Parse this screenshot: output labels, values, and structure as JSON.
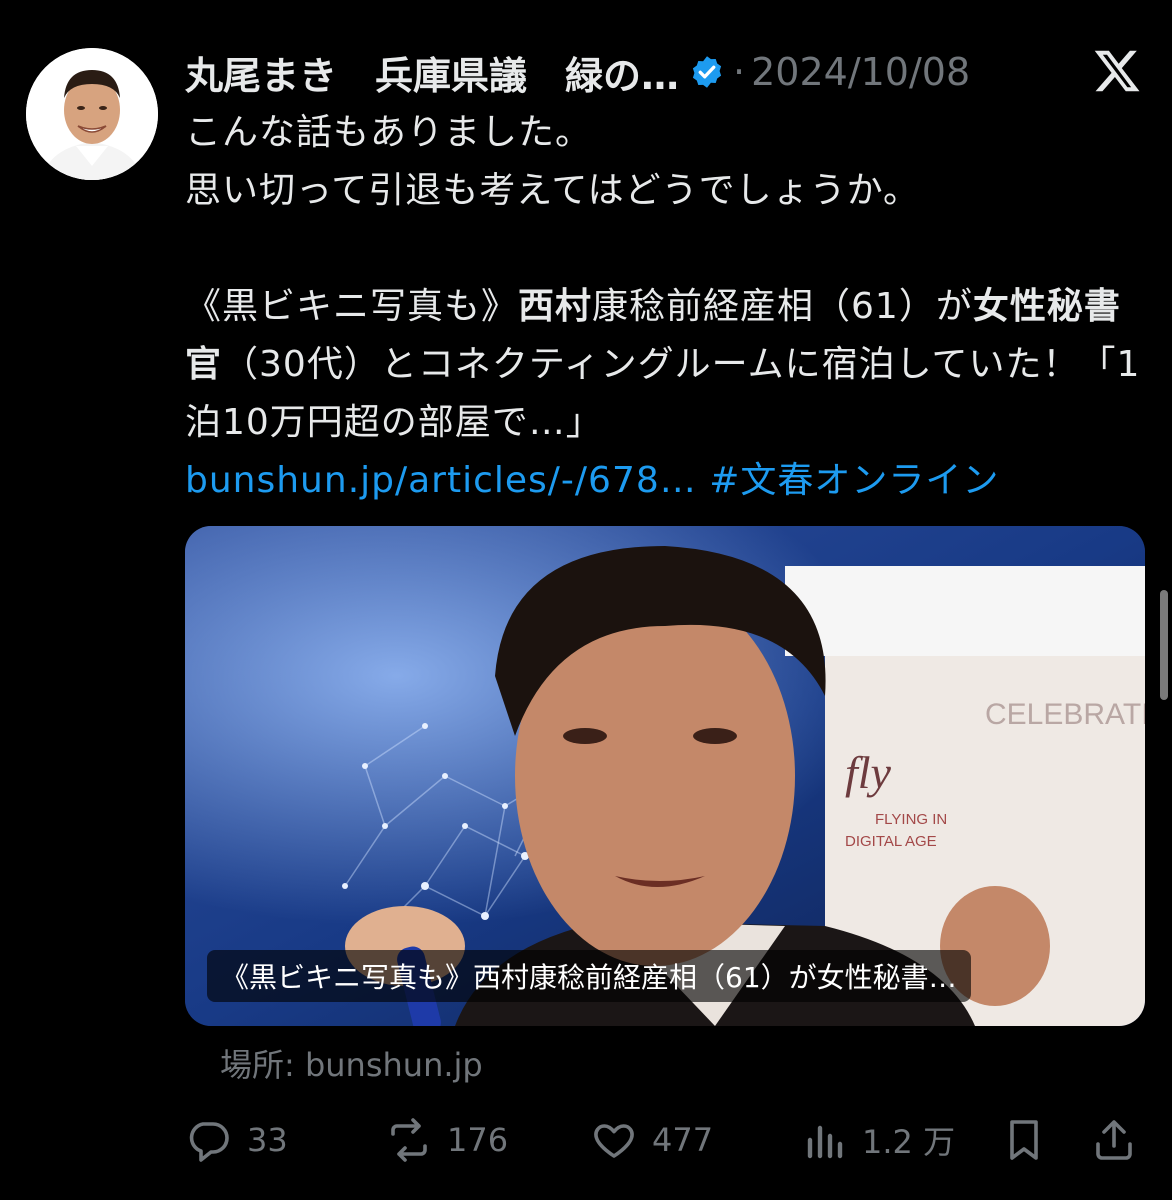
{
  "author": {
    "display_name": "丸尾まき　兵庫県議　緑の…",
    "separator": "·",
    "date": "2024/10/08"
  },
  "icons": {
    "avatar": "avatar-photo",
    "verified": "verified-badge-icon",
    "platform": "x-logo-icon",
    "reply": "reply-icon",
    "repost": "repost-icon",
    "like": "like-icon",
    "views": "views-icon",
    "bookmark": "bookmark-icon",
    "share": "share-icon"
  },
  "colors": {
    "background": "#000000",
    "text": "#e7e9ea",
    "muted": "#71767b",
    "link": "#1d9bf0",
    "verified": "#1d9bf0"
  },
  "text": {
    "line1": "こんな話もありました。",
    "line2": "思い切って引退も考えてはどうでしょうか。",
    "headline_open": "《黒ビキニ写真も》",
    "headline_name": "西村",
    "headline_mid": "康稔前経産相（61）が",
    "headline_bold": "女性秘書官",
    "headline_rest": "（30代）とコネクティングルームに宿泊していた！「1泊10万円超の部屋で…」",
    "url": "bunshun.jp/articles/-/678…",
    "hashtag": "#文春オンライン"
  },
  "card": {
    "caption": "《黒ビキニ写真も》西村康稔前経産相（61）が女性秘書…",
    "source": "場所: bunshun.jp",
    "backdrop_text": "CELEBRATING",
    "backdrop_sub1": "fly",
    "backdrop_sub2": "FLYING IN",
    "backdrop_sub3": "DIGITAL AGE"
  },
  "stats": {
    "replies": "33",
    "reposts": "176",
    "likes": "477",
    "views": "1.2 万"
  }
}
